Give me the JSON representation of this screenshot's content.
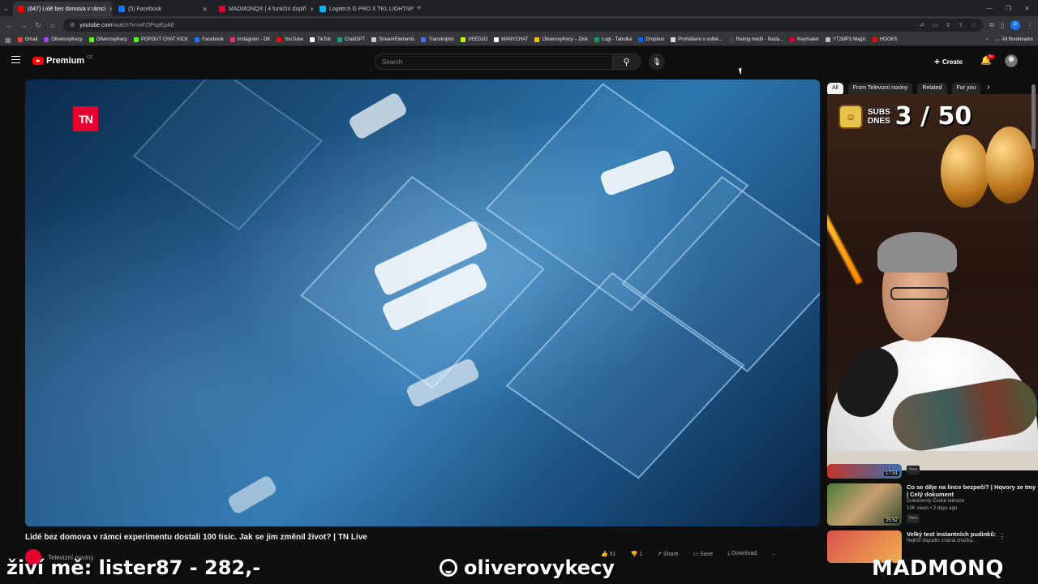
{
  "browser": {
    "tabs": [
      {
        "label": "(647) Lidé bez domova v rámci",
        "color": "#ff0000"
      },
      {
        "label": "(5) Facebook",
        "color": "#1877f2"
      },
      {
        "label": "MADMONQ® | 4 funkční doplň",
        "color": "#e4032e"
      },
      {
        "label": "Logitech G PRO X TKL LIGHTSP",
        "color": "#00b8fc"
      }
    ],
    "url_host": "youtube.com",
    "url_path": "/watch?v=wFZlPspEpAE",
    "bookmarks": [
      "Gmail",
      "OliverovyKecy",
      "OliverovyKecy",
      "POPOUT CHAT KICK",
      "Facebook",
      "Instagram - OK",
      "YouTube",
      "TikTok",
      "ChatGPT",
      "StreamElements",
      "Transkriptor",
      "VEEDJO",
      "MANYCHAT",
      "OliverovyKecy – Disk",
      "Logi - Tabulka",
      "Dropbox",
      "Prohlášení o volbě...",
      "Rating médií - Nada...",
      "Keymailer",
      "YT2MP3 Magic",
      "HOOKS"
    ],
    "all_bookmarks": "All Bookmarks",
    "profile_initial": "P"
  },
  "youtube": {
    "logo_text": "Premium",
    "logo_country": "CZ",
    "search_placeholder": "Search",
    "create_label": "Create",
    "notification_count": "9+",
    "chips": [
      "All",
      "From Televizní noviny",
      "Related",
      "For you"
    ],
    "video": {
      "title": "Lidé bez domova v rámci experimentu dostali 100 tisíc. Jak se jim změnil život? | TN Live",
      "channel": "Televizní noviny",
      "tn_logo": "TN",
      "actions": [
        "91",
        "1",
        "Share",
        "Save",
        "Download",
        "..."
      ]
    },
    "recommendations": [
      {
        "duration": "17:51",
        "title": "",
        "channel": "",
        "meta": "",
        "badge": "New"
      },
      {
        "duration": "25:52",
        "title": "Co se děje na lince bezpečí? | Hovory ze tmy | Celý dokument",
        "channel": "Dokumenty České televize",
        "meta": "10K views • 3 days ago",
        "badge": "New"
      },
      {
        "duration": "",
        "title": "Velký test instantních pudinků:",
        "channel": "Nejhůř dopadlo známá značka...",
        "meta": "",
        "badge": ""
      }
    ]
  },
  "webcam": {
    "counter_label_1": "SUBS",
    "counter_label_2": "DNES",
    "counter_value": "3 / 50"
  },
  "stream_overlay": {
    "left_text": "živí mě: lister87 - 282,-",
    "mid_text": "oliverovykecy",
    "right_text": "MADMONQ"
  },
  "colors": {
    "yt_red": "#ff0000",
    "tn_red": "#e4032e",
    "bg": "#0f0f0f"
  }
}
